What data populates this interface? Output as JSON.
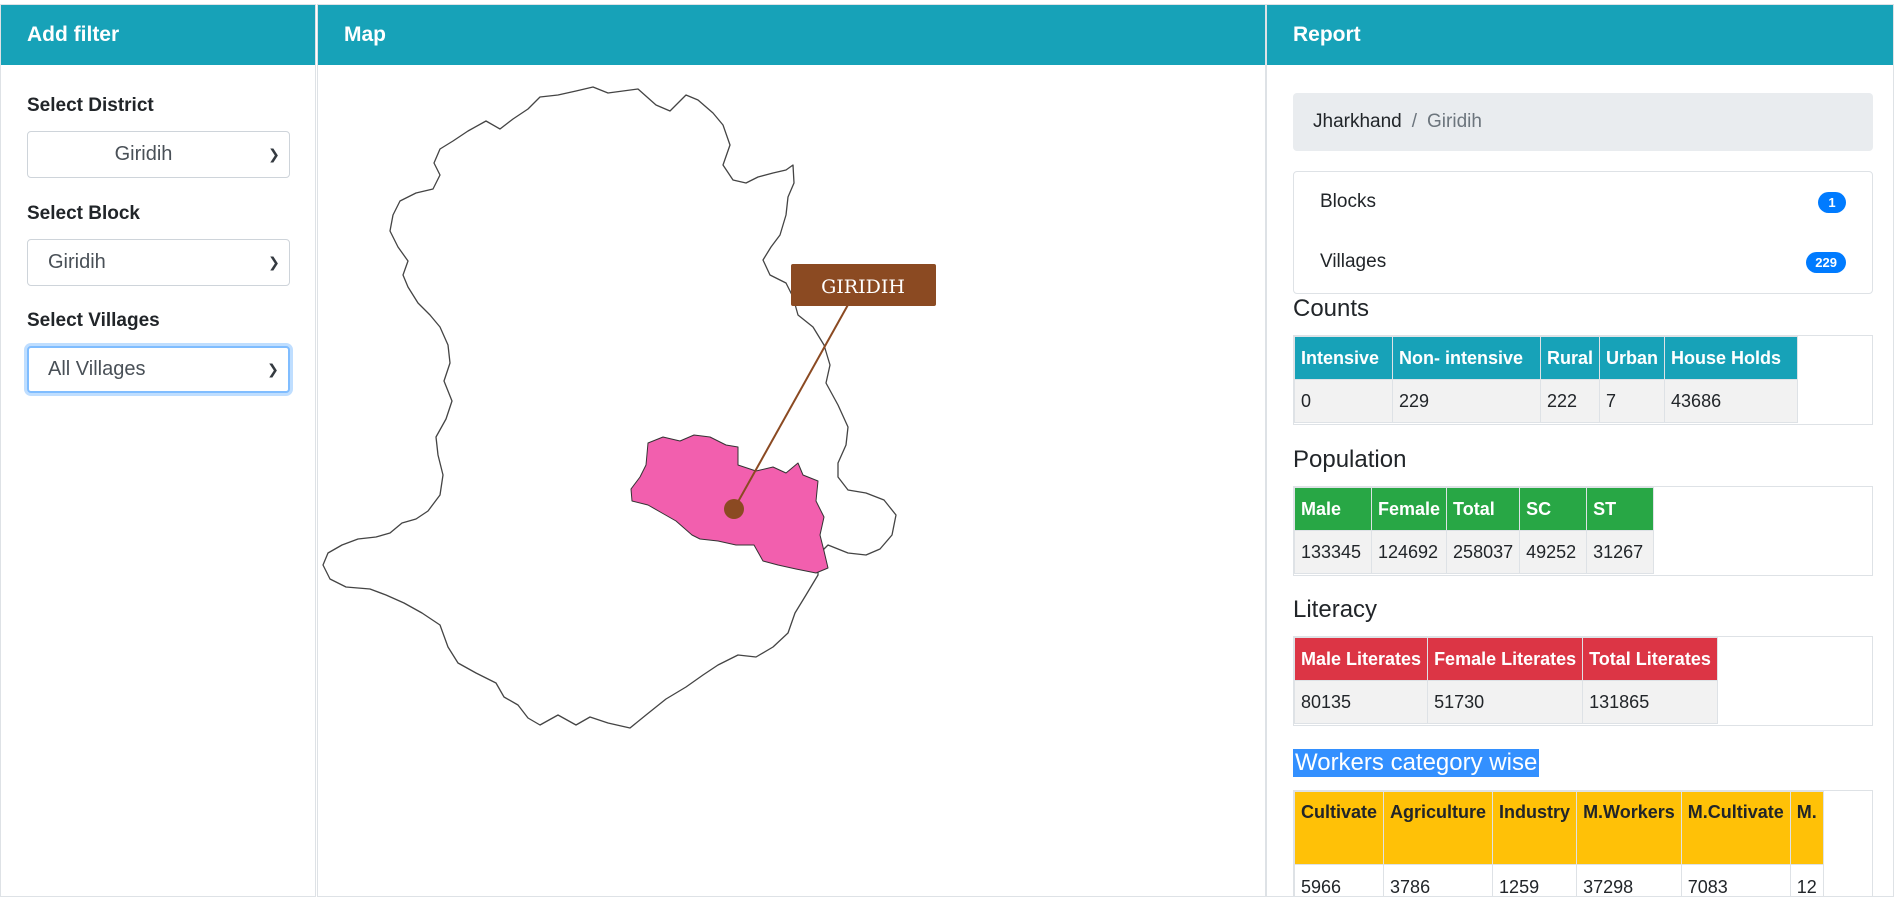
{
  "filter": {
    "title": "Add filter",
    "district_label": "Select District",
    "district_value": "Giridih",
    "block_label": "Select Block",
    "block_value": "Giridih",
    "villages_label": "Select Villages",
    "villages_value": "All Villages"
  },
  "map": {
    "title": "Map",
    "marker_label": "GIRIDIH",
    "district_fill": "#ffffff",
    "block_fill": "#f25fae",
    "marker_color": "#8b4a22"
  },
  "report": {
    "title": "Report",
    "breadcrumb": {
      "state": "Jharkhand",
      "separator": "/",
      "district": "Giridih"
    },
    "summary": [
      {
        "label": "Blocks",
        "count": "1"
      },
      {
        "label": "Villages",
        "count": "229"
      }
    ],
    "counts": {
      "title": "Counts",
      "headers": [
        "Intensive",
        "Non- intensive",
        "Rural",
        "Urban",
        "House Holds"
      ],
      "values": [
        "0",
        "229",
        "222",
        "7",
        "43686"
      ]
    },
    "population": {
      "title": "Population",
      "headers": [
        "Male",
        "Female",
        "Total",
        "SC",
        "ST"
      ],
      "values": [
        "133345",
        "124692",
        "258037",
        "49252",
        "31267"
      ]
    },
    "literacy": {
      "title": "Literacy",
      "headers": [
        "Male Literates",
        "Female Literates",
        "Total Literates"
      ],
      "values": [
        "80135",
        "51730",
        "131865"
      ]
    },
    "workers": {
      "title": "Workers category wise",
      "headers": [
        "Cultivate",
        "Agriculture",
        "Industry",
        "M.Workers",
        "M.Cultivate",
        "M."
      ],
      "values": [
        "5966",
        "3786",
        "1259",
        "37298",
        "7083",
        "12"
      ]
    }
  }
}
